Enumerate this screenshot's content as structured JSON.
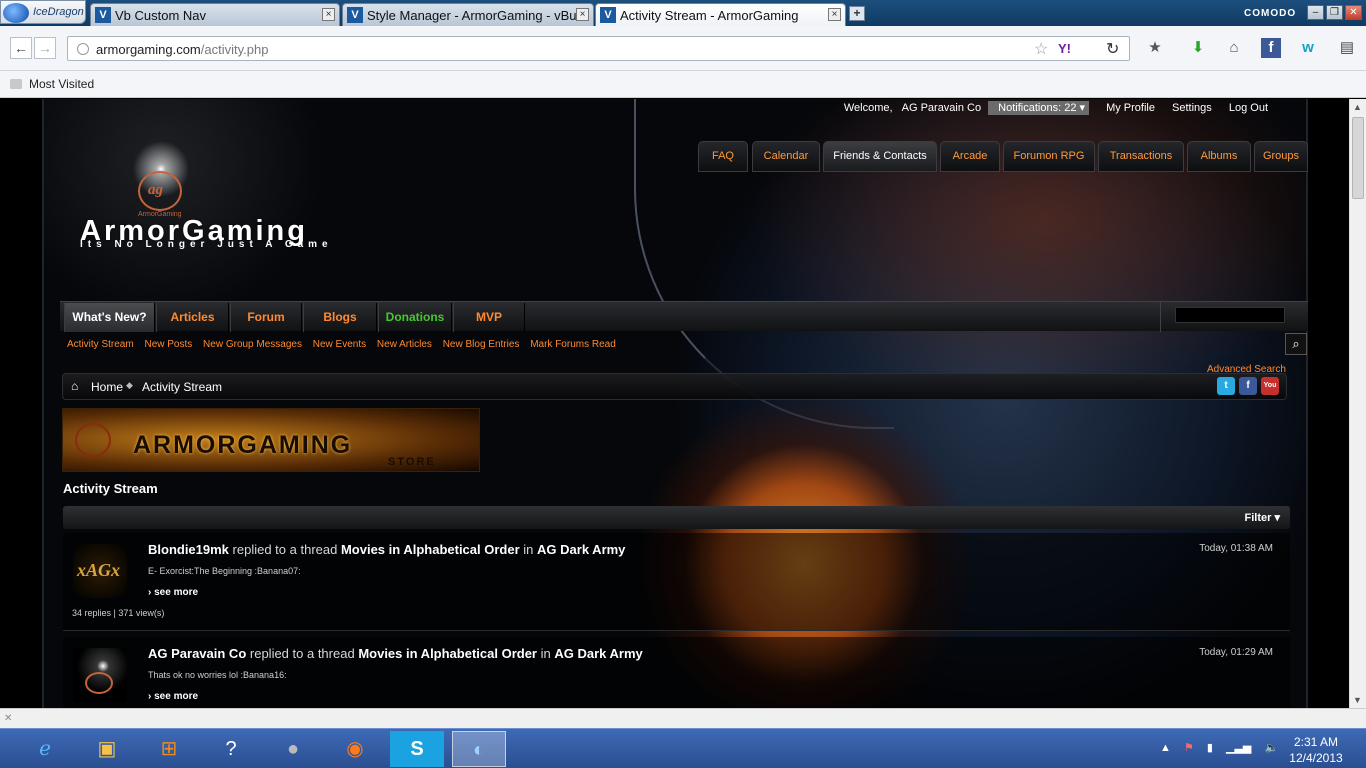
{
  "browser": {
    "app_name": "IceDragon",
    "tabs": [
      {
        "title": "Vb Custom Nav"
      },
      {
        "title": "Style Manager - ArmorGaming - vBulle..."
      },
      {
        "title": "Activity Stream - ArmorGaming"
      }
    ],
    "brand": "COMODO",
    "url_host": "armorgaming.com",
    "url_path": "/activity.php",
    "bookmarks_label": "Most Visited",
    "search_engine": "Y!"
  },
  "site": {
    "user": {
      "welcome": "Welcome,",
      "name": "AG Paravain Co",
      "notifications": "Notifications: 22",
      "profile": "My Profile",
      "settings": "Settings",
      "logout": "Log Out"
    },
    "top_nav": [
      "FAQ",
      "Calendar",
      "Friends & Contacts",
      "Arcade",
      "Forumon RPG",
      "Transactions",
      "Albums",
      "Groups"
    ],
    "logo": {
      "brand": "ArmorGaming",
      "tagline": "Its No Longer Just A Game",
      "emblem": "ag",
      "emblem_small": "ArmorGaming"
    },
    "main_nav": [
      "What's New?",
      "Articles",
      "Forum",
      "Blogs",
      "Donations",
      "MVP"
    ],
    "sub_nav": [
      "Activity Stream",
      "New Posts",
      "New Group Messages",
      "New Events",
      "New Articles",
      "New Blog Entries",
      "Mark Forums Read"
    ],
    "advanced_search": "Advanced Search",
    "breadcrumb": {
      "home": "Home",
      "current": "Activity Stream"
    },
    "store_banner": {
      "title": "ARMORGAMING",
      "sub": "STORE"
    },
    "page_title": "Activity Stream",
    "filter": "Filter",
    "activity": [
      {
        "user": "Blondie19mk",
        "verb": "replied to a thread",
        "thread": "Movies in Alphabetical Order",
        "prep": "in",
        "group": "AG Dark Army",
        "time": "Today, 01:38 AM",
        "excerpt": "E- Exorcist:The Beginning :Banana07:",
        "more": "see more",
        "stats": "34 replies | 371 view(s)",
        "avatar_text": "xAGx"
      },
      {
        "user": "AG Paravain Co",
        "verb": "replied to a thread",
        "thread": "Movies in Alphabetical Order",
        "prep": "in",
        "group": "AG Dark Army",
        "time": "Today, 01:29 AM",
        "excerpt": "Thats ok no worries lol :Banana16:",
        "more": "see more",
        "stats": ""
      }
    ]
  },
  "os": {
    "clock_time": "2:31 AM",
    "clock_date": "12/4/2013"
  }
}
